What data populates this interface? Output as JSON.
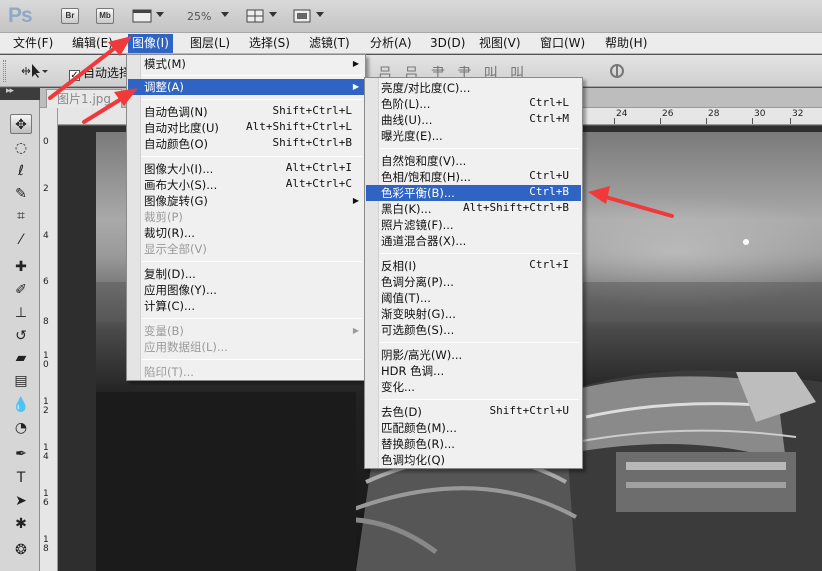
{
  "app": {
    "logo": "Ps",
    "bridge_label": "Br",
    "minibridge_label": "Mb",
    "zoom": "25%"
  },
  "menubar": [
    {
      "label": "文件(F)"
    },
    {
      "label": "编辑(E)"
    },
    {
      "label": "图像(I)"
    },
    {
      "label": "图层(L)"
    },
    {
      "label": "选择(S)"
    },
    {
      "label": "滤镜(T)"
    },
    {
      "label": "分析(A)"
    },
    {
      "label": "3D(D)"
    },
    {
      "label": "视图(V)"
    },
    {
      "label": "窗口(W)"
    },
    {
      "label": "帮助(H)"
    }
  ],
  "options": {
    "auto_select_label": "自动选择",
    "align_icons": "吕 吕 肀 肀 叫 叫"
  },
  "document": {
    "tab_title": "图片1.jpg"
  },
  "ruler": {
    "h_ticks": [
      "24",
      "26",
      "28",
      "30",
      "32"
    ],
    "v_ticks": [
      "0",
      "2",
      "4",
      "6",
      "8",
      "1 0",
      "1 2",
      "1 4",
      "1 6",
      "1 8"
    ]
  },
  "image_menu": [
    {
      "label": "模式(M)",
      "shortcut": "",
      "submenu": true,
      "disabled": false
    },
    {
      "sep": true
    },
    {
      "label": "调整(A)",
      "shortcut": "",
      "submenu": true,
      "disabled": false,
      "highlight": true
    },
    {
      "sep": true
    },
    {
      "label": "自动色调(N)",
      "shortcut": "Shift+Ctrl+L"
    },
    {
      "label": "自动对比度(U)",
      "shortcut": "Alt+Shift+Ctrl+L"
    },
    {
      "label": "自动颜色(O)",
      "shortcut": "Shift+Ctrl+B"
    },
    {
      "sep": true
    },
    {
      "label": "图像大小(I)...",
      "shortcut": "Alt+Ctrl+I"
    },
    {
      "label": "画布大小(S)...",
      "shortcut": "Alt+Ctrl+C"
    },
    {
      "label": "图像旋转(G)",
      "shortcut": "",
      "submenu": true
    },
    {
      "label": "裁剪(P)",
      "shortcut": "",
      "disabled": true
    },
    {
      "label": "裁切(R)...",
      "shortcut": ""
    },
    {
      "label": "显示全部(V)",
      "shortcut": "",
      "disabled": true
    },
    {
      "sep": true
    },
    {
      "label": "复制(D)...",
      "shortcut": ""
    },
    {
      "label": "应用图像(Y)...",
      "shortcut": ""
    },
    {
      "label": "计算(C)...",
      "shortcut": ""
    },
    {
      "sep": true
    },
    {
      "label": "变量(B)",
      "shortcut": "",
      "submenu": true,
      "disabled": true
    },
    {
      "label": "应用数据组(L)...",
      "shortcut": "",
      "disabled": true
    },
    {
      "sep": true
    },
    {
      "label": "陷印(T)...",
      "shortcut": "",
      "disabled": true
    }
  ],
  "adjust_menu": [
    {
      "label": "亮度/对比度(C)...",
      "shortcut": ""
    },
    {
      "label": "色阶(L)...",
      "shortcut": "Ctrl+L"
    },
    {
      "label": "曲线(U)...",
      "shortcut": "Ctrl+M"
    },
    {
      "label": "曝光度(E)...",
      "shortcut": ""
    },
    {
      "sep": true
    },
    {
      "label": "自然饱和度(V)...",
      "shortcut": ""
    },
    {
      "label": "色相/饱和度(H)...",
      "shortcut": "Ctrl+U"
    },
    {
      "label": "色彩平衡(B)...",
      "shortcut": "Ctrl+B",
      "highlight": true
    },
    {
      "label": "黑白(K)...",
      "shortcut": "Alt+Shift+Ctrl+B"
    },
    {
      "label": "照片滤镜(F)...",
      "shortcut": ""
    },
    {
      "label": "通道混合器(X)...",
      "shortcut": ""
    },
    {
      "sep": true
    },
    {
      "label": "反相(I)",
      "shortcut": "Ctrl+I"
    },
    {
      "label": "色调分离(P)...",
      "shortcut": ""
    },
    {
      "label": "阈值(T)...",
      "shortcut": ""
    },
    {
      "label": "渐变映射(G)...",
      "shortcut": ""
    },
    {
      "label": "可选颜色(S)...",
      "shortcut": ""
    },
    {
      "sep": true
    },
    {
      "label": "阴影/高光(W)...",
      "shortcut": ""
    },
    {
      "label": "HDR 色调...",
      "shortcut": ""
    },
    {
      "label": "变化...",
      "shortcut": ""
    },
    {
      "sep": true
    },
    {
      "label": "去色(D)",
      "shortcut": "Shift+Ctrl+U"
    },
    {
      "label": "匹配颜色(M)...",
      "shortcut": ""
    },
    {
      "label": "替换颜色(R)...",
      "shortcut": ""
    },
    {
      "label": "色调均化(Q)",
      "shortcut": ""
    }
  ],
  "tools": [
    {
      "icon": "move-icon",
      "glyph": "✥"
    },
    {
      "icon": "marquee-icon",
      "glyph": "◌"
    },
    {
      "icon": "lasso-icon",
      "glyph": "ℓ"
    },
    {
      "icon": "quick-select-icon",
      "glyph": "✎"
    },
    {
      "icon": "crop-icon",
      "glyph": "⌗"
    },
    {
      "icon": "eyedropper-icon",
      "glyph": "⁄"
    },
    {
      "icon": "healing-brush-icon",
      "glyph": "✚"
    },
    {
      "icon": "brush-icon",
      "glyph": "✐"
    },
    {
      "icon": "clone-stamp-icon",
      "glyph": "⊥"
    },
    {
      "icon": "history-brush-icon",
      "glyph": "↺"
    },
    {
      "icon": "eraser-icon",
      "glyph": "▰"
    },
    {
      "icon": "gradient-icon",
      "glyph": "▤"
    },
    {
      "icon": "blur-icon",
      "glyph": "💧"
    },
    {
      "icon": "dodge-icon",
      "glyph": "◔"
    },
    {
      "icon": "pen-icon",
      "glyph": "✒"
    },
    {
      "icon": "type-icon",
      "glyph": "T"
    },
    {
      "icon": "path-select-icon",
      "glyph": "➤"
    },
    {
      "icon": "shape-icon",
      "glyph": "✱"
    },
    {
      "icon": "3d-rotate-icon",
      "glyph": "❂"
    }
  ],
  "colors": {
    "highlight": "#2f64c4",
    "annotation_arrow": "#f03a3a"
  }
}
